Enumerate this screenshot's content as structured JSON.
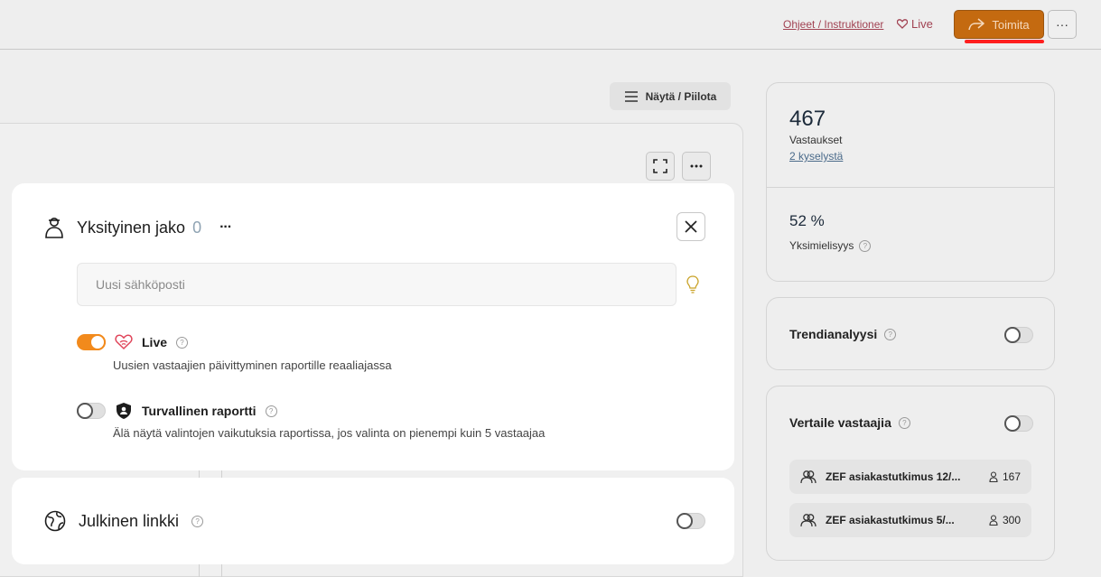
{
  "topbar": {
    "help_link": "Ohjeet / Instruktioner",
    "live_label": "Live",
    "primary_button": "Toimita",
    "more_label": "···"
  },
  "toolbar": {
    "show_hide": "Näytä / Piilota"
  },
  "stats": {
    "responses_value": "467",
    "responses_label": "Vastaukset",
    "surveys_link": "2 kyselystä",
    "consensus_value": "52 %",
    "consensus_label": "Yksimielisyys"
  },
  "trend": {
    "title": "Trendianalyysi",
    "enabled": false
  },
  "compare": {
    "title": "Vertaile vastaajia",
    "enabled": false,
    "surveys": [
      {
        "name": "ZEF asiakastutkimus 12/...",
        "count": "167"
      },
      {
        "name": "ZEF asiakastutkimus 5/...",
        "count": "300"
      }
    ]
  },
  "private_share": {
    "title": "Yksityinen jako",
    "count": "0",
    "more_label": "···",
    "email_placeholder": "Uusi sähköposti",
    "options": [
      {
        "title": "Live",
        "enabled": true,
        "description": "Uusien vastaajien päivittyminen raportille reaaliajassa"
      },
      {
        "title": "Turvallinen raportti",
        "enabled": false,
        "description": "Älä näytä valintojen vaikutuksia raportissa, jos valinta on pienempi kuin 5 vastaajaa"
      }
    ]
  },
  "public_link": {
    "title": "Julkinen linkki",
    "enabled": false
  },
  "colors": {
    "accent": "#f28a1c",
    "live_red": "#e0455a"
  }
}
